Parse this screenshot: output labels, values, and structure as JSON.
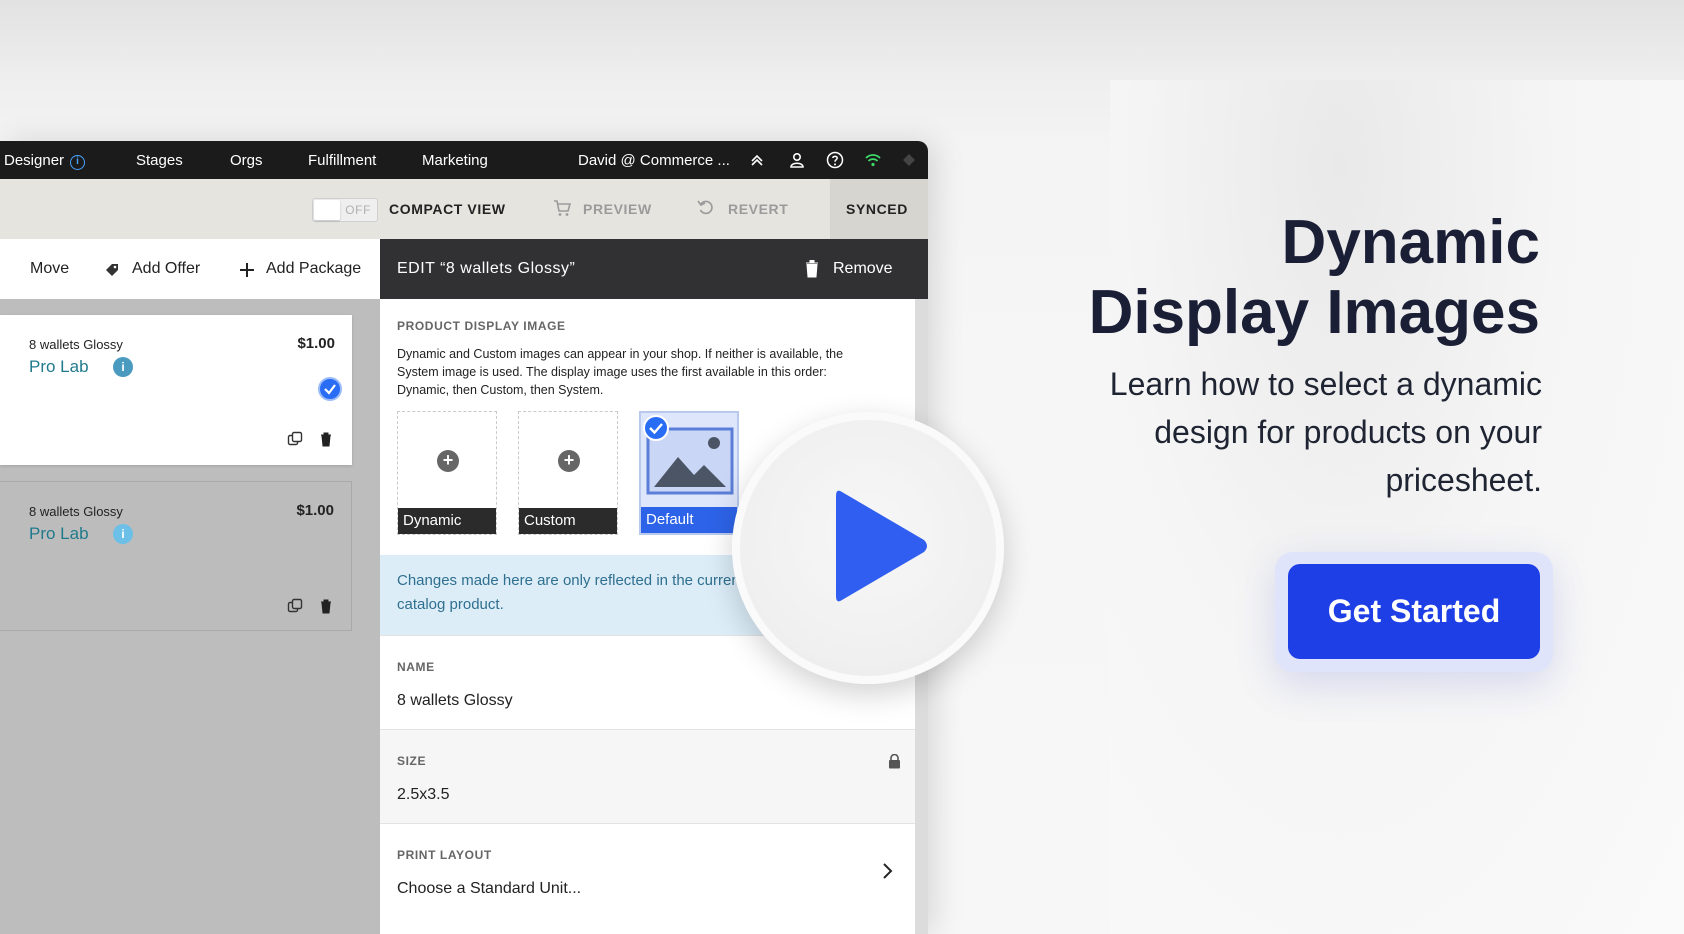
{
  "topnav": {
    "items": [
      "Designer",
      "Stages",
      "Orgs",
      "Fulfillment",
      "Marketing"
    ],
    "user": "David @ Commerce ..."
  },
  "toolbar": {
    "toggle_state": "OFF",
    "compact_view": "COMPACT VIEW",
    "preview": "PREVIEW",
    "revert": "REVERT",
    "synced": "SYNCED"
  },
  "actions": {
    "move": "Move",
    "add_offer": "Add Offer",
    "add_package": "Add Package"
  },
  "products": [
    {
      "name": "8 wallets Glossy",
      "price": "$1.00",
      "lab": "Pro Lab",
      "selected": true
    },
    {
      "name": "8 wallets Glossy",
      "price": "$1.00",
      "lab": "Pro Lab",
      "selected": false
    }
  ],
  "edit": {
    "title": "EDIT “8 wallets Glossy”",
    "remove": "Remove",
    "pdi_label": "PRODUCT DISPLAY IMAGE",
    "pdi_desc": "Dynamic and Custom images can appear in your shop. If neither is available, the System image is used. The display image uses the first available in this order: Dynamic, then Custom, then System.",
    "tiles": [
      "Dynamic",
      "Custom",
      "Default"
    ],
    "notice": "Changes made here are only reflected in the current price sheet, not the catalog product.",
    "name_label": "NAME",
    "name_value": "8 wallets Glossy",
    "size_label": "SIZE",
    "size_value": "2.5x3.5",
    "print_layout_label": "PRINT LAYOUT",
    "print_layout_value": "Choose a Standard Unit..."
  },
  "hero": {
    "title_line1": "Dynamic",
    "title_line2": "Display Images",
    "subtitle": "Learn how to select a dynamic design for products on your pricesheet.",
    "cta": "Get Started"
  },
  "colors": {
    "accent": "#1f3fe6",
    "check": "#2a6df5",
    "lab_text": "#1f7a8c",
    "title_text": "#1a1f36"
  }
}
